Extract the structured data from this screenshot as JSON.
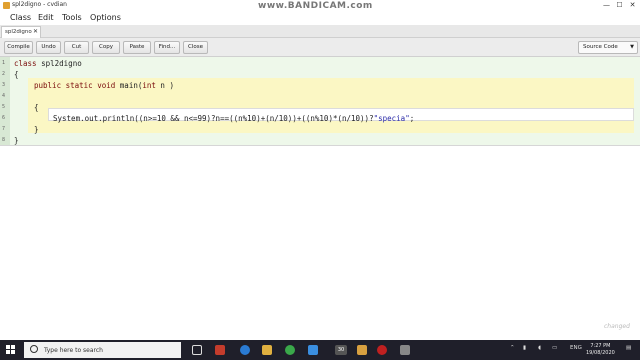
{
  "window": {
    "title": "spl2digno - cvdian",
    "watermark": "www.BANDICAM.com",
    "controls": [
      "—",
      "☐",
      "✕"
    ]
  },
  "menu": [
    "Class",
    "Edit",
    "Tools",
    "Options"
  ],
  "tab": {
    "label": "spl2digno",
    "close": "✕"
  },
  "toolbar": {
    "buttons": [
      "Compile",
      "Undo",
      "Cut",
      "Copy",
      "Paste",
      "Find...",
      "Close"
    ],
    "view_select": "Source Code"
  },
  "editor": {
    "line_numbers": [
      "1",
      "2",
      "3",
      "4",
      "5",
      "6",
      "7",
      "8"
    ],
    "lines": {
      "l1_kw": "class",
      "l1_rest": " spl2digno",
      "l2": "{",
      "l3_kw": "public static void",
      "l3_mid": " main(",
      "l3_kw2": "int",
      "l3_rest": " n )",
      "l5": "{",
      "l6_code": "System.out.println((n>=10 && n<=99)?n==((n%10)+(n/10))+((n%10)*(n/10))?",
      "l6_str": "\"specia\"",
      "l6_end": ";",
      "l7": "}",
      "l8": "}"
    }
  },
  "status": {
    "changed": "changed"
  },
  "taskbar": {
    "search_placeholder": "Type here to search",
    "badge": "30",
    "lang": "ENG",
    "time": "7:27 PM",
    "date": "19/08/2020"
  },
  "colors": {
    "editor_bg": "#eef8ea",
    "method_block": "#fbf7c4",
    "keyword": "#7a0a0a",
    "string": "#2a2aa8",
    "taskbar": "#1f1f2a"
  }
}
